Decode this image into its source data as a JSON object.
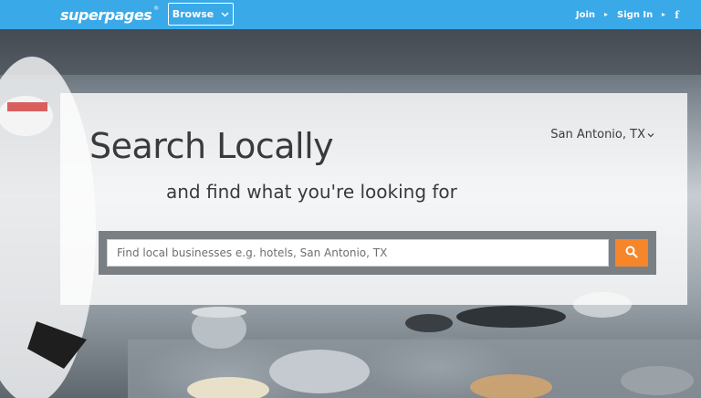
{
  "header": {
    "logo_text": "superpages",
    "logo_tm": "®",
    "browse_label": "Browse",
    "join_label": "Join",
    "signin_label": "Sign In",
    "facebook_label": "f"
  },
  "hero": {
    "headline": "Search Locally",
    "subheadline": "and find what you're looking for",
    "location": "San Antonio, TX",
    "search": {
      "value": "",
      "placeholder": "Find local businesses e.g. hotels, San Antonio, TX"
    }
  },
  "colors": {
    "brand_blue": "#3aa9e8",
    "search_orange": "#f5862a"
  },
  "icons": {
    "search": "magnifier-icon",
    "browse_chevron": "chevron-down-icon",
    "location_chevron": "chevron-down-icon"
  }
}
